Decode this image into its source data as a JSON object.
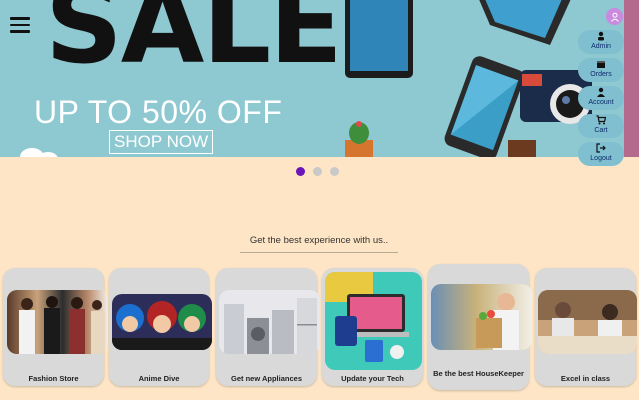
{
  "banner": {
    "headline": "SALE",
    "subline": "UP TO 50% OFF",
    "cta": "SHOP NOW"
  },
  "menu": {
    "icon": "hamburger-menu-icon"
  },
  "sidenav": {
    "user_icon": "user-icon",
    "items": [
      {
        "label": "Admin",
        "icon": "user-admin-icon"
      },
      {
        "label": "Orders",
        "icon": "box-icon"
      },
      {
        "label": "Account",
        "icon": "person-icon"
      },
      {
        "label": "Cart",
        "icon": "cart-icon"
      },
      {
        "label": "Logout",
        "icon": "logout-icon"
      }
    ]
  },
  "carousel": {
    "slides": 3,
    "active": 1
  },
  "tagline": "Get the best experience with us..",
  "categories": [
    {
      "label": "Fashion Store"
    },
    {
      "label": "Anime Dive"
    },
    {
      "label": "Get new Appliances"
    },
    {
      "label": "Update your Tech"
    },
    {
      "label": "Be the best HouseKeeper"
    },
    {
      "label": "Excel in class"
    }
  ],
  "colors": {
    "page_bg": "#fde5c6",
    "banner_bg": "#8ec8d1",
    "nav_pill": "#7fbfcf",
    "dot_active": "#6a16b8",
    "card_bg": "#d9d9d9"
  }
}
